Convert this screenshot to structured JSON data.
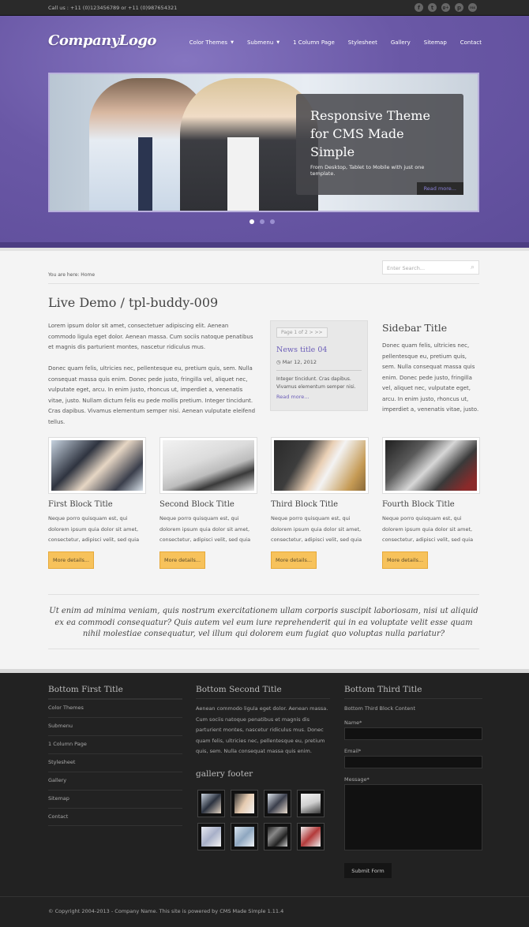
{
  "topbar": {
    "call_text": "Call us : +11 (0)123456789 or +11 (0)987654321",
    "social": [
      "f",
      "t",
      "g+",
      "p",
      "rss"
    ]
  },
  "header": {
    "logo": "CompanyLogo",
    "nav": [
      {
        "label": "Color Themes",
        "caret": true
      },
      {
        "label": "Submenu",
        "caret": true
      },
      {
        "label": "1 Column Page",
        "caret": false
      },
      {
        "label": "Stylesheet",
        "caret": false
      },
      {
        "label": "Gallery",
        "caret": false
      },
      {
        "label": "Sitemap",
        "caret": false
      },
      {
        "label": "Contact",
        "caret": false
      }
    ]
  },
  "slider": {
    "title": "Responsive Theme for CMS Made Simple",
    "subtitle": "From Desktop, Tablet to Mobile with just one template.",
    "more": "Read more..."
  },
  "search": {
    "placeholder": "Enter Search..."
  },
  "breadcrumb": "You are here: Home",
  "main": {
    "title": "Live Demo / tpl-buddy-009",
    "para1": "Lorem ipsum dolor sit amet, consectetuer adipiscing elit. Aenean commodo ligula eget dolor. Aenean massa. Cum sociis natoque penatibus et magnis dis parturient montes, nascetur ridiculus mus.",
    "para2": "Donec quam felis, ultricies nec, pellentesque eu, pretium quis, sem. Nulla consequat massa quis enim. Donec pede justo, fringilla vel, aliquet nec, vulputate eget, arcu. In enim justo, rhoncus ut, imperdiet a, venenatis vitae, justo. Nullam dictum felis eu pede mollis pretium. Integer tincidunt. Cras dapibus. Vivamus elementum semper nisi. Aenean vulputate eleifend tellus."
  },
  "news": {
    "pager": "Page 1 of 2  >  >>",
    "title": "News title 04",
    "date": "Mar 12, 2012",
    "body": "Integer tincidunt.  Cras dapibus. Vivamus elementum semper nisi.",
    "more": "Read more..."
  },
  "sidebar": {
    "title": "Sidebar Title",
    "text": "Donec quam felis, ultricies nec, pellentesque eu, pretium quis, sem. Nulla consequat massa quis enim. Donec pede justo, fringilla vel, aliquet nec, vulputate eget, arcu. In enim justo, rhoncus ut, imperdiet a, venenatis vitae, justo."
  },
  "blocks": [
    {
      "title": "First Block Title",
      "text": "Neque porro quisquam est, qui dolorem ipsum quia dolor sit amet, consectetur, adipisci velit, sed quia",
      "button": "More details..."
    },
    {
      "title": "Second Block Title",
      "text": "Neque porro quisquam est, qui dolorem ipsum quia dolor sit amet, consectetur, adipisci velit, sed quia",
      "button": "More details..."
    },
    {
      "title": "Third Block Title",
      "text": "Neque porro quisquam est, qui dolorem ipsum quia dolor sit amet, consectetur, adipisci velit, sed quia",
      "button": "More details..."
    },
    {
      "title": "Fourth Block Title",
      "text": "Neque porro quisquam est, qui dolorem ipsum quia dolor sit amet, consectetur, adipisci velit, sed quia",
      "button": "More details..."
    }
  ],
  "quote": "Ut enim ad minima veniam, quis nostrum exercitationem ullam corporis suscipit laboriosam, nisi ut aliquid ex ea commodi consequatur? Quis autem vel eum iure reprehenderit qui in ea voluptate velit esse quam nihil molestiae consequatur, vel illum qui dolorem eum fugiat quo voluptas nulla pariatur?",
  "footer": {
    "col1_title": "Bottom First Title",
    "links": [
      "Color Themes",
      "Submenu",
      "1 Column Page",
      "Stylesheet",
      "Gallery",
      "Sitemap",
      "Contact"
    ],
    "col2_title": "Bottom Second Title",
    "col2_text": "Aenean commodo ligula eget dolor. Aenean massa. Cum sociis natoque penatibus et magnis dis parturient montes, nascetur ridiculus mus. Donec quam felis, ultricies nec, pellentesque eu, pretium quis, sem. Nulla consequat massa quis enim.",
    "gallery_title": "gallery footer",
    "col3_title": "Bottom Third Title",
    "col3_text": "Bottom Third Block Content",
    "name_label": "Name*",
    "email_label": "Email*",
    "message_label": "Message*",
    "submit": "Submit Form",
    "copyright": "© Copyright 2004-2013 - Company Name. This site is powered by CMS Made Simple 1.11.4"
  }
}
